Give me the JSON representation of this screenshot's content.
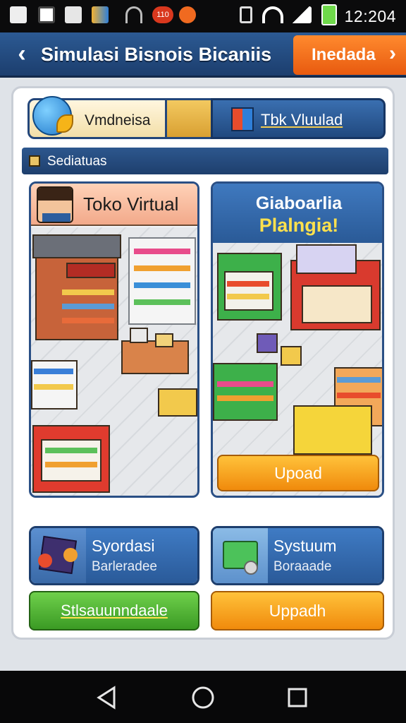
{
  "status_bar": {
    "time": "12:204",
    "icons": [
      "app-icon",
      "image-icon",
      "photo-icon",
      "store-icon",
      "wifi-signal-icon",
      "notification-badge-icon",
      "fire-icon",
      "vibrate-icon",
      "wifi-icon",
      "cell-signal-icon",
      "battery-icon"
    ],
    "notification_badge": "110"
  },
  "app_bar": {
    "title": "Simulasi Bisnois Bicaniis",
    "action_label": "Inedada",
    "back_icon": "chevron-left-icon",
    "action_icon": "chevron-right-icon"
  },
  "tabs": [
    {
      "label": "Vmdneisa",
      "icon": "globe-icon",
      "selected": true
    },
    {
      "label": "Tbk Vluulad",
      "icon": "shopping-bag-icon",
      "selected": false
    }
  ],
  "section": {
    "label": "Sediatuas"
  },
  "store_cards": [
    {
      "title": "Toko Virtual",
      "icon": "avatar-icon",
      "scene_label": "store-scene"
    },
    {
      "title_line1": "Giaboarlia",
      "title_line2": "Plalngia!",
      "button_label": "Upoad",
      "scene_label": "market-scene"
    }
  ],
  "info_cards": [
    {
      "title": "Syordasi",
      "subtitle": "Barleradee",
      "icon": "gift-box-icon"
    },
    {
      "title": "Systuum",
      "subtitle": "Boraaade",
      "icon": "shopping-bag-icon"
    }
  ],
  "buttons": {
    "left_label": "Stlsauunndaale",
    "right_label": "Uppadh"
  },
  "nav_bar": {
    "icons": [
      "back-triangle-icon",
      "home-circle-icon",
      "recents-square-icon"
    ]
  },
  "colors": {
    "primary_blue": "#2a5a97",
    "accent_orange": "#f08a0c",
    "accent_green": "#3b9a24",
    "highlight_yellow": "#ffe14d"
  }
}
